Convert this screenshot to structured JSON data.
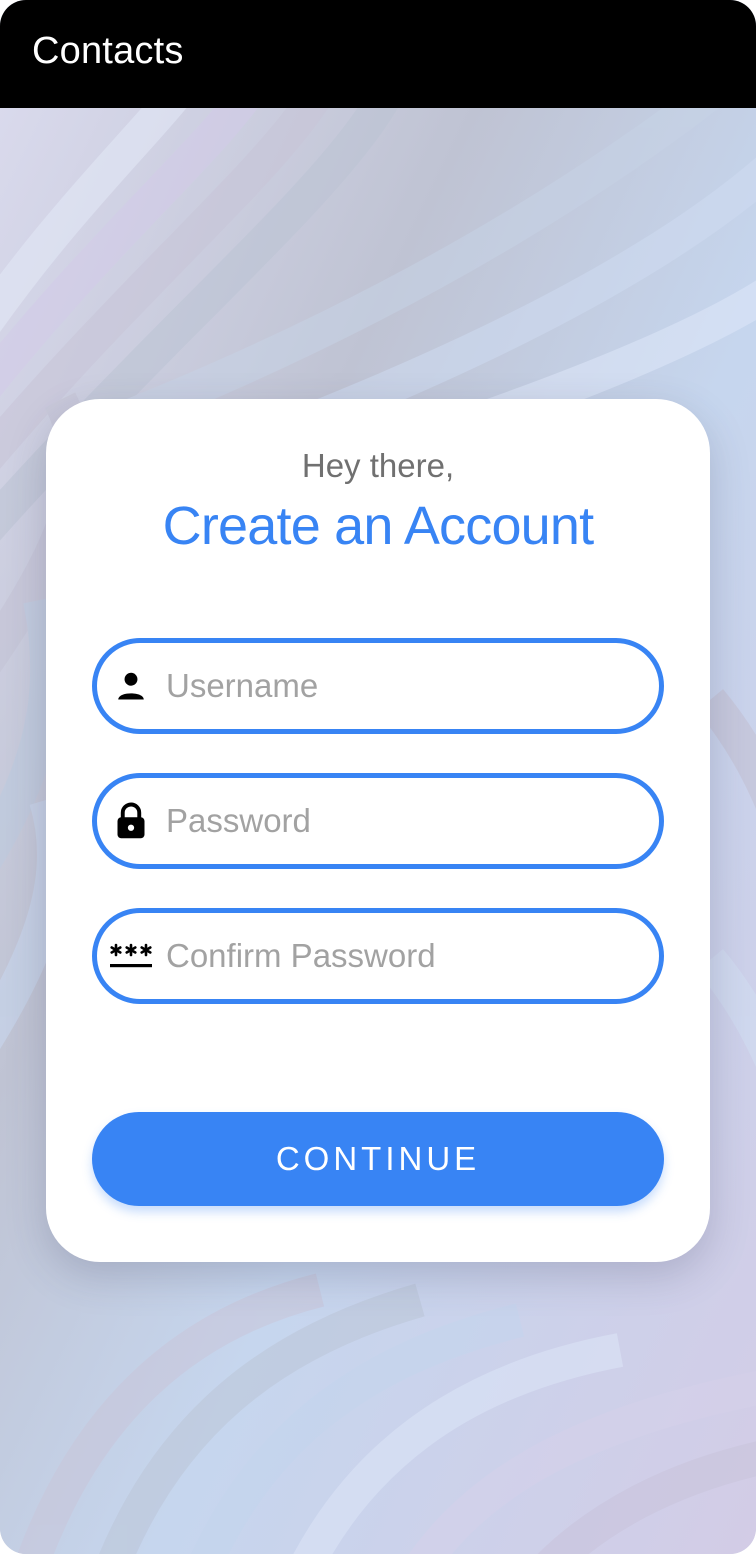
{
  "appbar": {
    "title": "Contacts"
  },
  "form": {
    "greeting": "Hey there,",
    "headline": "Create an Account",
    "fields": [
      {
        "icon": "person-icon",
        "placeholder": "Username",
        "value": ""
      },
      {
        "icon": "lock-icon",
        "placeholder": "Password",
        "value": ""
      },
      {
        "icon": "password-dots-icon",
        "placeholder": "Confirm Password",
        "value": ""
      }
    ],
    "continue_label": "CONTINUE"
  },
  "colors": {
    "accent": "#3884f4",
    "appbar": "#000000",
    "card": "#ffffff",
    "greeting_text": "#707070",
    "placeholder_text": "#a2a2a2"
  }
}
